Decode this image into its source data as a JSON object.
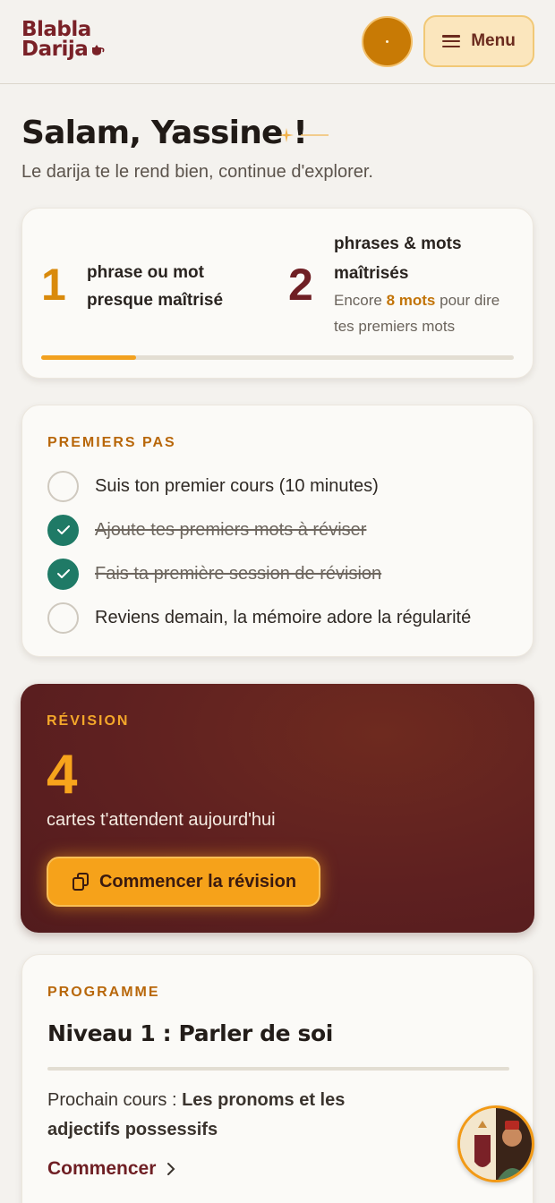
{
  "header": {
    "logo_line1": "Blabla",
    "logo_line2": "Darija",
    "menu_label": "Menu"
  },
  "greeting": {
    "title": "Salam, Yassine !",
    "subtitle": "Le darija te le rend bien, continue d'explorer."
  },
  "stats": {
    "almost_count": "1",
    "almost_label": "phrase ou mot presque maîtrisé",
    "mastered_count": "2",
    "mastered_label": "phrases & mots maîtrisés",
    "remaining_prefix": "Encore ",
    "remaining_highlight": "8 mots",
    "remaining_suffix": " pour dire tes premiers mots",
    "progress_fraction": 0.2
  },
  "first_steps": {
    "heading": "PREMIERS PAS",
    "items": [
      {
        "label": "Suis ton premier cours (10 minutes)",
        "done": false
      },
      {
        "label": "Ajoute tes premiers mots à réviser",
        "done": true
      },
      {
        "label": "Fais ta première session de révision",
        "done": true
      },
      {
        "label": "Reviens demain, la mémoire adore la régularité",
        "done": false
      }
    ]
  },
  "review": {
    "heading": "RÉVISION",
    "count": "4",
    "label": "cartes t'attendent aujourd'hui",
    "button_label": "Commencer la révision"
  },
  "program": {
    "heading": "PROGRAMME",
    "level_title": "Niveau 1 : Parler de soi",
    "next_prefix": "Prochain cours : ",
    "next_lesson": "Les pronoms et les adjectifs possessifs",
    "start_label": "Commencer"
  },
  "colors": {
    "brand": "#7a2127",
    "accent": "#f6a21a",
    "success": "#1f7a66"
  }
}
